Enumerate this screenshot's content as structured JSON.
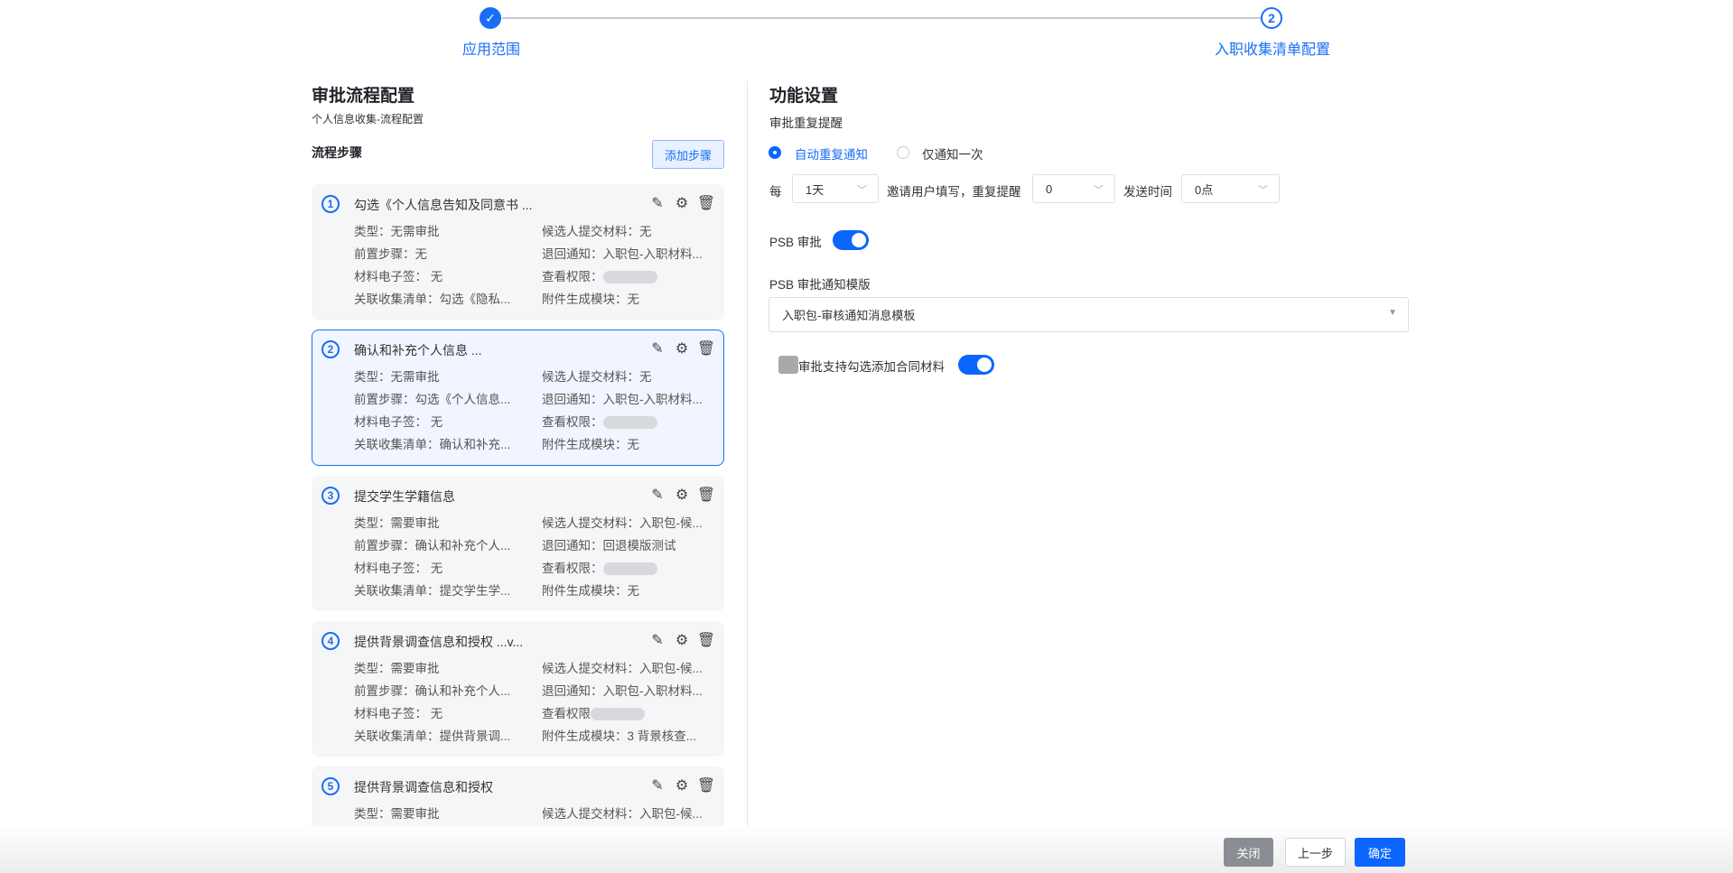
{
  "steps": [
    {
      "label": "应用范围",
      "state": "done"
    },
    {
      "label": "入职收集清单配置",
      "number": "2",
      "state": "current"
    }
  ],
  "left": {
    "title": "审批流程配置",
    "subtitle": "个人信息收集-流程配置",
    "section": "流程步骤",
    "add_button": "添加步骤",
    "cards": [
      {
        "n": "1",
        "title": "勾选《个人信息告知及同意书 ...",
        "type": "类型：无需审批",
        "submit": "候选人提交材料：无",
        "pre": "前置步骤：无",
        "back": "退回通知：入职包-入职材料...",
        "esign": "材料电子签：  无",
        "view": "查看权限：",
        "list": "关联收集清单：勾选《隐私...",
        "attach": "附件生成模块：无"
      },
      {
        "n": "2",
        "title": "确认和补充个人信息 ...",
        "type": "类型：无需审批",
        "submit": "候选人提交材料：无",
        "pre": "前置步骤：勾选《个人信息...",
        "back": "退回通知：入职包-入职材料...",
        "esign": "材料电子签：  无",
        "view": "查看权限：",
        "list": "关联收集清单：确认和补充...",
        "attach": "附件生成模块：无"
      },
      {
        "n": "3",
        "title": "提交学生学籍信息",
        "type": "类型：需要审批",
        "submit": "候选人提交材料：入职包-候...",
        "pre": "前置步骤：确认和补充个人...",
        "back": "退回通知：回退模版测试",
        "esign": "材料电子签：  无",
        "view": "查看权限：",
        "list": "关联收集清单：提交学生学...",
        "attach": "附件生成模块：无"
      },
      {
        "n": "4",
        "title": "提供背景调查信息和授权 ...v...",
        "type": "类型：需要审批",
        "submit": "候选人提交材料：入职包-候...",
        "pre": "前置步骤：确认和补充个人...",
        "back": "退回通知：入职包-入职材料...",
        "esign": "材料电子签：  无",
        "view": "查看权限",
        "list": "关联收集清单：提供背景调...",
        "attach": "附件生成模块：3 背景核查..."
      },
      {
        "n": "5",
        "title": "提供背景调查信息和授权",
        "type": "类型：需要审批",
        "submit": "候选人提交材料：入职包-候..."
      }
    ]
  },
  "right": {
    "title": "功能设置",
    "remind_label": "审批重复提醒",
    "radio_auto": "自动重复通知",
    "radio_once": "仅通知一次",
    "every": "每",
    "every_value": "1天",
    "invite_text": "邀请用户填写，重复提醒",
    "repeat_value": "0",
    "send_time_label": "发送时间",
    "send_time_value": "0点",
    "psb_label": "PSB 审批",
    "psb_on": true,
    "template_label": "PSB 审批通知模版",
    "template_value": "入职包-审核通知消息模板",
    "contract_label": "审批支持勾选添加合同材料",
    "contract_on": true
  },
  "footer": {
    "close": "关闭",
    "prev": "上一步",
    "ok": "确定"
  },
  "colors": {
    "primary": "#0a66ff",
    "accent": "#1a6ef5"
  }
}
